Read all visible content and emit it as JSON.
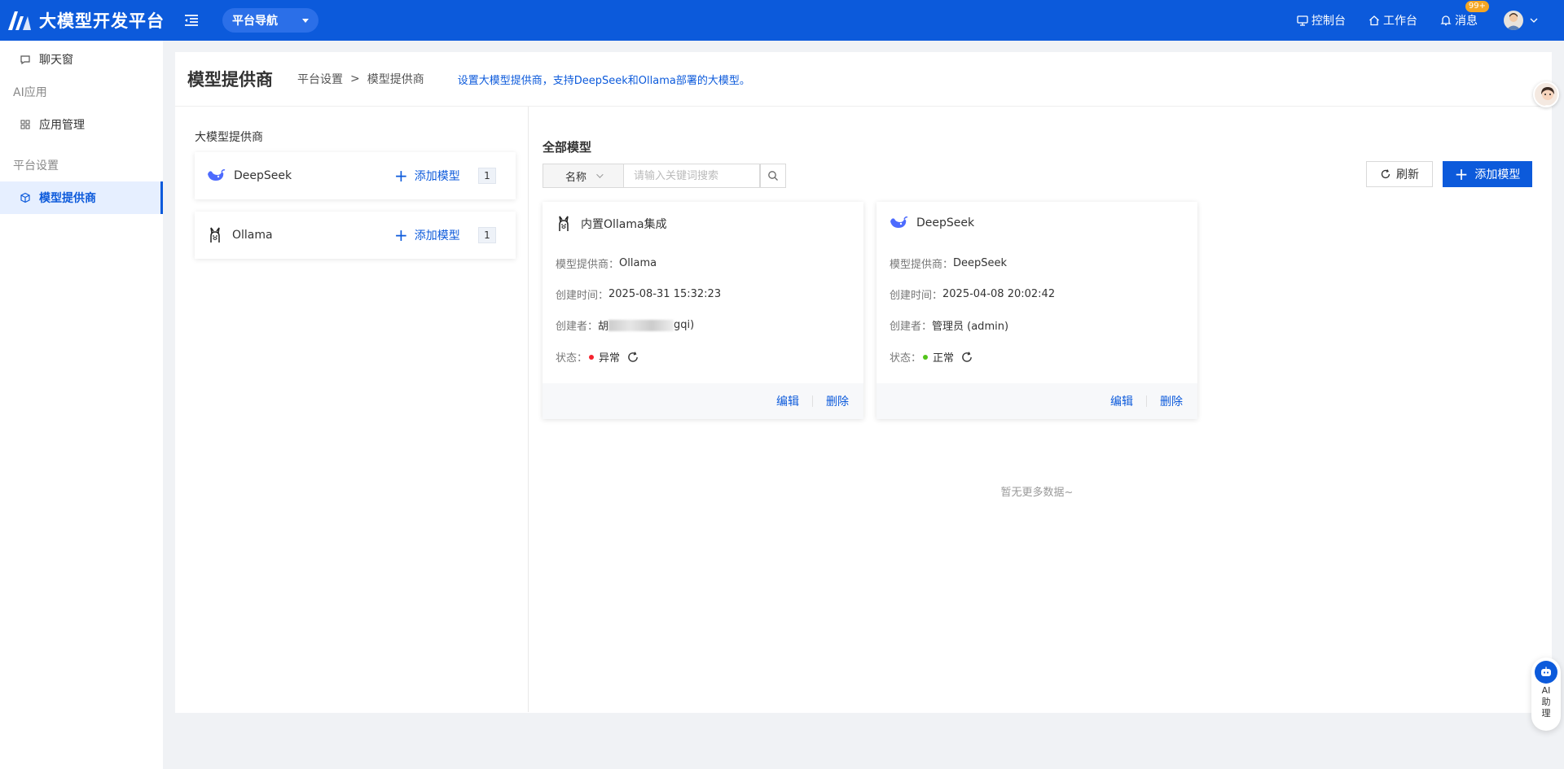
{
  "app": {
    "title": "大模型开发平台",
    "nav_dropdown": "平台导航"
  },
  "top_right": {
    "console": "控制台",
    "workbench": "工作台",
    "messages": "消息",
    "messages_badge": "99+"
  },
  "sidebar": {
    "chat": "聊天窗",
    "group_ai": "AI应用",
    "app_manage": "应用管理",
    "group_platform": "平台设置",
    "model_provider": "模型提供商"
  },
  "header": {
    "title": "模型提供商",
    "breadcrumb": [
      "平台设置",
      "模型提供商"
    ],
    "breadcrumb_sep": ">",
    "description": "设置大模型提供商，支持DeepSeek和Ollama部署的大模型。"
  },
  "providers": {
    "title": "大模型提供商",
    "add_label": "添加模型",
    "items": [
      {
        "name": "DeepSeek",
        "count": "1"
      },
      {
        "name": "Ollama",
        "count": "1"
      }
    ]
  },
  "models": {
    "title": "全部模型",
    "search_field": "名称",
    "search_placeholder": "请输入关键词搜索",
    "refresh_label": "刷新",
    "add_label": "添加模型",
    "labels": {
      "provider": "模型提供商：",
      "created_at": "创建时间：",
      "creator": "创建者：",
      "status": "状态："
    },
    "edit_label": "编辑",
    "delete_label": "删除",
    "cards": [
      {
        "title": "内置Ollama集成",
        "provider": "Ollama",
        "created_at": "2025-08-31 15:32:23",
        "creator_prefix": "胡",
        "creator_suffix": "gqi)",
        "status": "异常",
        "status_color": "#f5222d"
      },
      {
        "title": "DeepSeek",
        "provider": "DeepSeek",
        "created_at": "2025-04-08 20:02:42",
        "creator": "管理员 (admin)",
        "status": "正常",
        "status_color": "#52c41a"
      }
    ],
    "no_more": "暂无更多数据~"
  },
  "ai_helper": {
    "label": "AI助理"
  },
  "colors": {
    "primary": "#0c5adb",
    "topbar": "#0c5adb",
    "badge": "#f5a623"
  }
}
